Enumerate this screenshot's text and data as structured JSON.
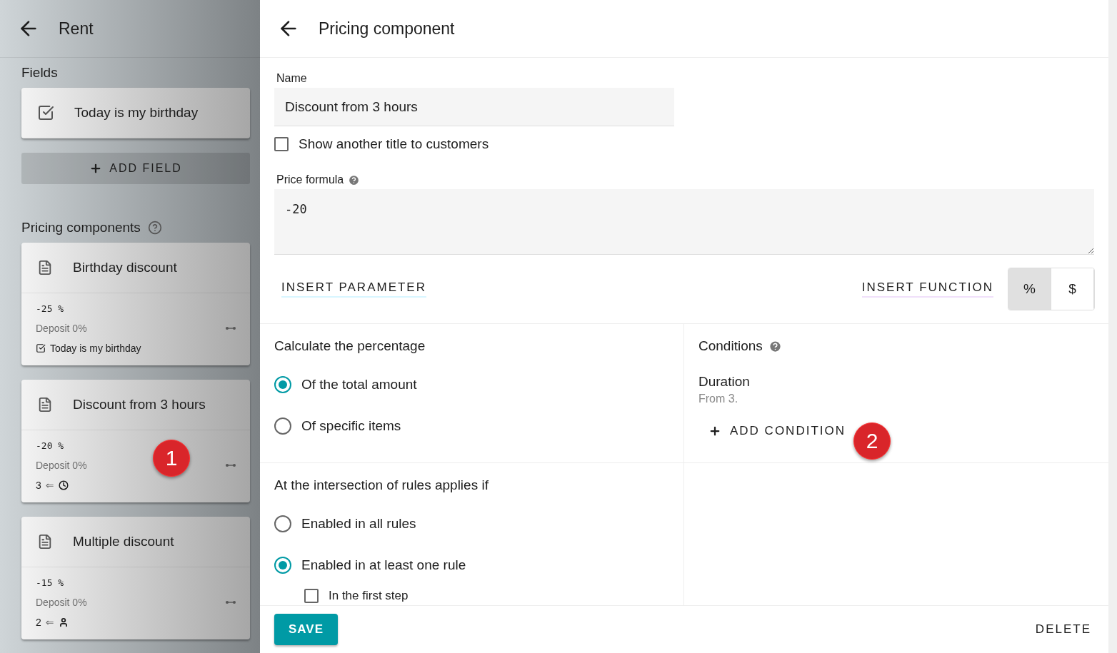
{
  "sidebar": {
    "title": "Rent",
    "fields_heading": "Fields",
    "fields": [
      {
        "label": "Today is my birthday",
        "kind": "checkbox"
      }
    ],
    "add_field": {
      "label": "ADD FIELD"
    },
    "components_heading": "Pricing components",
    "components": [
      {
        "title": "Birthday discount",
        "value": "-25 %",
        "deposit": "Deposit 0%",
        "condition": {
          "kind": "checkbox",
          "label": "Today is my birthday"
        }
      },
      {
        "title": "Discount from 3 hours",
        "value": "-20 %",
        "deposit": "Deposit 0%",
        "condition": {
          "kind": "duration",
          "label": "3",
          "arrow": "⇐"
        },
        "badge": "1"
      },
      {
        "title": "Multiple discount",
        "value": "-15 %",
        "deposit": "Deposit 0%",
        "condition": {
          "kind": "people",
          "label": "2",
          "arrow": "⇐"
        }
      }
    ]
  },
  "editor": {
    "title": "Pricing component",
    "name_label": "Name",
    "name_value": "Discount from 3 hours",
    "alt_title": {
      "label": "Show another title to customers",
      "checked": false
    },
    "formula_label": "Price formula",
    "formula_value": "-20",
    "insert_parameter": "INSERT PARAMETER",
    "insert_function": "INSERT FUNCTION",
    "units": [
      {
        "label": "%",
        "selected": true
      },
      {
        "label": "$",
        "selected": false
      }
    ],
    "calc_heading": "Calculate the percentage",
    "calc_options": [
      {
        "label": "Of the total amount",
        "selected": true
      },
      {
        "label": "Of specific items",
        "selected": false
      }
    ],
    "intersection_heading": "At the intersection of rules applies if",
    "intersection_options": [
      {
        "label": "Enabled in all rules",
        "selected": false
      },
      {
        "label": "Enabled in at least one rule",
        "selected": true
      }
    ],
    "first_step": {
      "label": "In the first step",
      "checked": false
    },
    "conditions_heading": "Conditions",
    "conditions": [
      {
        "title": "Duration",
        "detail": "From 3."
      }
    ],
    "add_condition": {
      "label": "ADD CONDITION"
    },
    "conditions_badge": "2",
    "save": "SAVE",
    "delete": "DELETE"
  }
}
